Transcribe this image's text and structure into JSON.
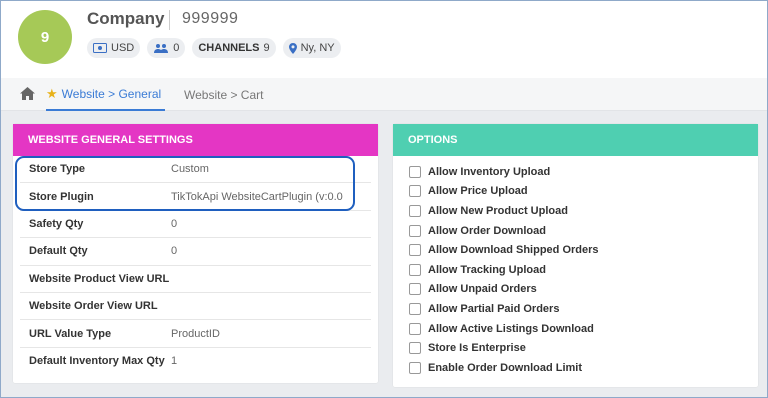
{
  "header": {
    "avatar_text": "9",
    "company_name": "Company",
    "company_id": "999999",
    "chips": {
      "currency": "USD",
      "users_count": "0",
      "channels_label": "CHANNELS",
      "channels_count": "9",
      "location": "Ny, NY"
    }
  },
  "tabs": [
    {
      "label": "Website > General",
      "active": true
    },
    {
      "label": "Website > Cart",
      "active": false
    }
  ],
  "general_settings": {
    "title": "WEBSITE GENERAL SETTINGS",
    "rows": [
      {
        "label": "Store Type",
        "value": "Custom"
      },
      {
        "label": "Store Plugin",
        "value": "TikTokApi WebsiteCartPlugin (v:0.0"
      },
      {
        "label": "Safety Qty",
        "value": "0"
      },
      {
        "label": "Default Qty",
        "value": "0"
      },
      {
        "label": "Website Product View URL",
        "value": ""
      },
      {
        "label": "Website Order View URL",
        "value": ""
      },
      {
        "label": "URL Value Type",
        "value": "ProductID"
      },
      {
        "label": "Default Inventory Max Qty",
        "value": "1"
      }
    ]
  },
  "options": {
    "title": "OPTIONS",
    "items": [
      "Allow Inventory Upload",
      "Allow Price Upload",
      "Allow New Product Upload",
      "Allow Order Download",
      "Allow Download Shipped Orders",
      "Allow Tracking Upload",
      "Allow Unpaid Orders",
      "Allow Partial Paid Orders",
      "Allow Active Listings Download",
      "Store Is Enterprise",
      "Enable Order Download Limit"
    ]
  },
  "colors": {
    "avatar": "#a6c957",
    "left_header": "#e436c4",
    "right_header": "#4fcfb1",
    "active_tab": "#3a7bd5",
    "highlight_border": "#1f5fbf"
  }
}
